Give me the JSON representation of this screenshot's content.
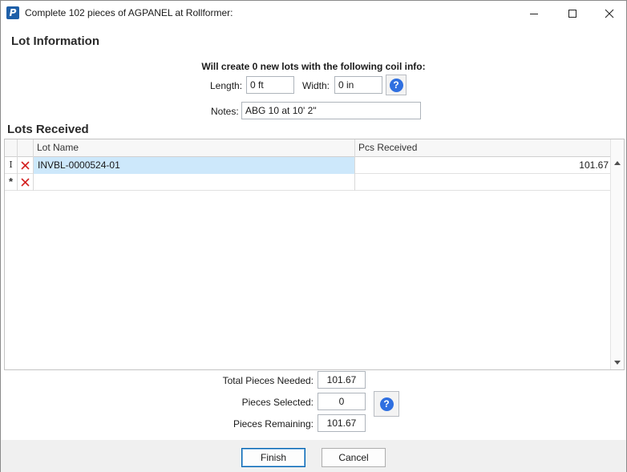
{
  "window": {
    "title": "Complete 102 pieces of AGPANEL at Rollformer:",
    "app_icon_letter": "P",
    "controls": [
      "minimize-icon",
      "maximize-icon",
      "close-icon"
    ]
  },
  "lot_info": {
    "heading": "Lot Information",
    "coil_heading": "Will create 0 new lots with the following coil info:",
    "length_label": "Length:",
    "length_value": "0 ft",
    "width_label": "Width:",
    "width_value": "0 in",
    "help_glyph": "?",
    "notes_label": "Notes:",
    "notes_value": "ABG 10 at 10' 2\""
  },
  "lots_received": {
    "heading": "Lots Received",
    "columns": [
      "Lot Name",
      "Pcs Received"
    ],
    "rows": [
      {
        "indicator": "I",
        "lot_name": "INVBL-0000524-01",
        "pcs_received": "101.67"
      },
      {
        "indicator": "*",
        "lot_name": "",
        "pcs_received": ""
      }
    ]
  },
  "summary": {
    "total_needed_label": "Total Pieces Needed:",
    "total_needed_value": "101.67",
    "selected_label": "Pieces Selected:",
    "selected_value": "0",
    "remaining_label": "Pieces Remaining:",
    "remaining_value": "101.67",
    "help_glyph": "?"
  },
  "buttons": {
    "finish": "Finish",
    "cancel": "Cancel"
  },
  "colors": {
    "selection": "#cde8fb",
    "help_blue": "#2f6fe0",
    "delete_red": "#d32020",
    "app_icon": "#1e5fa8"
  }
}
